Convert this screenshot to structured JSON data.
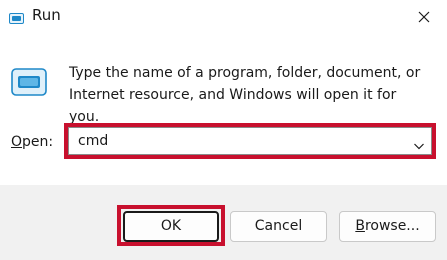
{
  "window": {
    "title": "Run",
    "title_icon": "run-dialog-icon",
    "close_icon": "close-icon"
  },
  "body": {
    "icon": "run-dialog-icon",
    "description": "Type the name of a program, folder, document, or Internet resource, and Windows will open it for you.",
    "open_label_accel": "O",
    "open_label_rest": "pen:",
    "open_value": "cmd",
    "dropdown_icon": "chevron-down-icon"
  },
  "buttons": {
    "ok": "OK",
    "cancel": "Cancel",
    "browse_accel": "B",
    "browse_rest": "rowse..."
  },
  "colors": {
    "highlight": "#c8102e",
    "icon_blue": "#1e88c8",
    "footer_bg": "#f1f1f1"
  }
}
